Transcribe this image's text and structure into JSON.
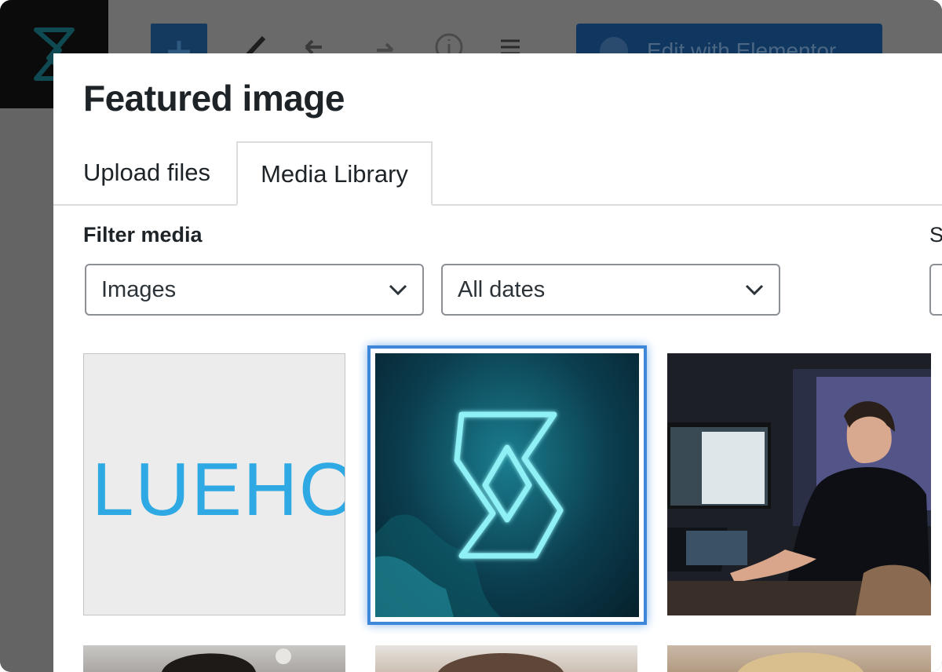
{
  "modal": {
    "title": "Featured image",
    "tabs": [
      {
        "label": "Upload files",
        "active": false
      },
      {
        "label": "Media Library",
        "active": true
      }
    ],
    "filter_label": "Filter media",
    "search_label": "S",
    "filters": {
      "type": {
        "selected": "Images"
      },
      "date": {
        "selected": "All dates"
      }
    },
    "media": [
      {
        "alt_text": "LUEHO",
        "selected": false
      },
      {
        "icon": "brand-logo-icon",
        "selected": true
      },
      {
        "icon": "person-at-computer-photo",
        "selected": false
      }
    ]
  },
  "background_editor": {
    "elementor_button": "Edit with Elementor"
  },
  "colors": {
    "modal_bg": "#ffffff",
    "overlay": "#646464",
    "select_border": "#8c8f94",
    "selected_outline": "#3f87d8",
    "text": "#1d2327",
    "bluehost_blue": "#2fa9e4"
  }
}
